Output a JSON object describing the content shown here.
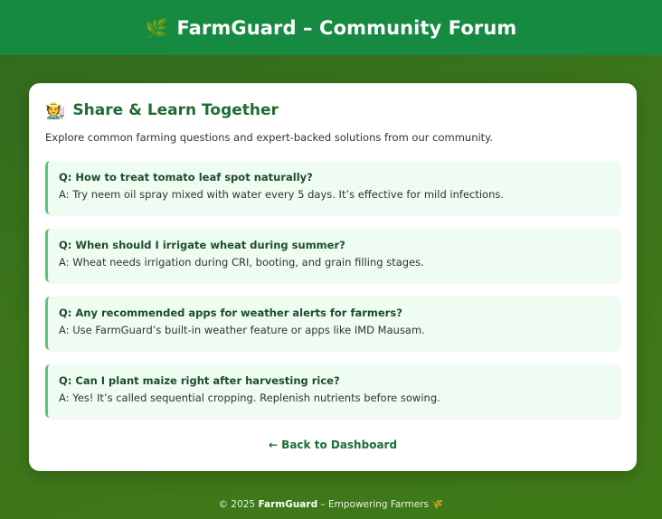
{
  "header": {
    "icon": "leaf-icon",
    "icon_glyph": "🌿",
    "title": "FarmGuard – Community Forum"
  },
  "card": {
    "icon": "farmer-icon",
    "icon_glyph": "🧑‍🌾",
    "heading": "Share & Learn Together",
    "intro": "Explore common farming questions and expert-backed solutions from our community.",
    "faqs": [
      {
        "q": "Q: How to treat tomato leaf spot naturally?",
        "a": "A: Try neem oil spray mixed with water every 5 days. It’s effective for mild infections."
      },
      {
        "q": "Q: When should I irrigate wheat during summer?",
        "a": "A: Wheat needs irrigation during CRI, booting, and grain filling stages."
      },
      {
        "q": "Q: Any recommended apps for weather alerts for farmers?",
        "a": "A: Use FarmGuard’s built-in weather feature or apps like IMD Mausam."
      },
      {
        "q": "Q: Can I plant maize right after harvesting rice?",
        "a": "A: Yes! It’s called sequential cropping. Replenish nutrients before sowing."
      }
    ],
    "back_link": "← Back to Dashboard"
  },
  "footer": {
    "prefix": "© 2025 ",
    "brand": "FarmGuard",
    "suffix": " – Empowering Farmers ",
    "icon": "wheat-icon",
    "icon_glyph": "🌾"
  },
  "colors": {
    "header_bg": "#178a41",
    "accent": "#1f6d33",
    "faq_bg": "#eefcf1",
    "faq_border": "#55c972"
  }
}
